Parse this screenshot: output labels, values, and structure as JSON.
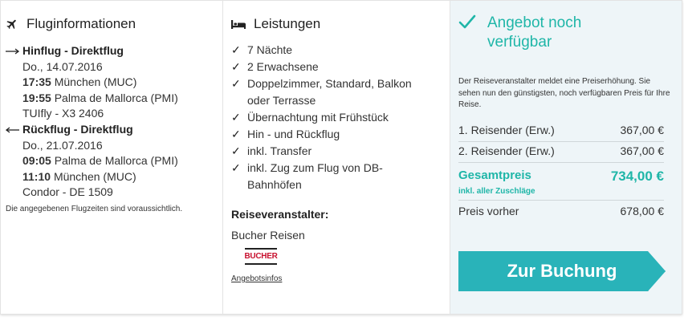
{
  "flug": {
    "title": "Fluginformationen",
    "hinflug": {
      "label": "Hinflug - Direktflug",
      "date": "Do., 14.07.2016",
      "dep_time": "17:35",
      "dep_place": "München (MUC)",
      "arr_time": "19:55",
      "arr_place": "Palma de Mallorca (PMI)",
      "airline": "TUIfly - X3 2406"
    },
    "rueckflug": {
      "label": "Rückflug - Direktflug",
      "date": "Do., 21.07.2016",
      "dep_time": "09:05",
      "dep_place": "Palma de Mallorca (PMI)",
      "arr_time": "11:10",
      "arr_place": "München (MUC)",
      "airline": "Condor - DE 1509"
    },
    "note": "Die angegebenen Flugzeiten sind voraussichtlich."
  },
  "leistungen": {
    "title": "Leistungen",
    "items": [
      "7 Nächte",
      "2 Erwachsene",
      "Doppelzimmer, Standard, Balkon oder Terrasse",
      "Übernachtung mit Frühstück",
      "Hin - und Rückflug",
      "inkl. Transfer",
      "inkl. Zug zum Flug von DB-Bahnhöfen"
    ],
    "veranstalter_label": "Reiseveranstalter:",
    "veranstalter_name": "Bucher Reisen",
    "logo_text": "BUCHER",
    "link": "Angebotsinfos"
  },
  "angebot": {
    "title": "Angebot noch verfügbar",
    "note": "Der Reiseveranstalter meldet eine Preiserhöhung. Sie sehen nun den günstigsten, noch verfügbaren Preis für Ihre Reise.",
    "rows": [
      {
        "label": "1. Reisender (Erw.)",
        "value": "367,00 €"
      },
      {
        "label": "2. Reisender (Erw.)",
        "value": "367,00 €"
      }
    ],
    "total_label": "Gesamtpreis",
    "total_value": "734,00 €",
    "incl_note": "inkl. aller Zuschläge",
    "prev_label": "Preis vorher",
    "prev_value": "678,00 €",
    "cta": "Zur Buchung"
  },
  "colors": {
    "accent": "#1fb6a8",
    "cta": "#29b3b9",
    "panel_bg": "#eef5f8"
  },
  "icons": [
    "plane-icon",
    "bed-icon",
    "arrow-right-icon",
    "arrow-left-icon",
    "check-icon"
  ]
}
